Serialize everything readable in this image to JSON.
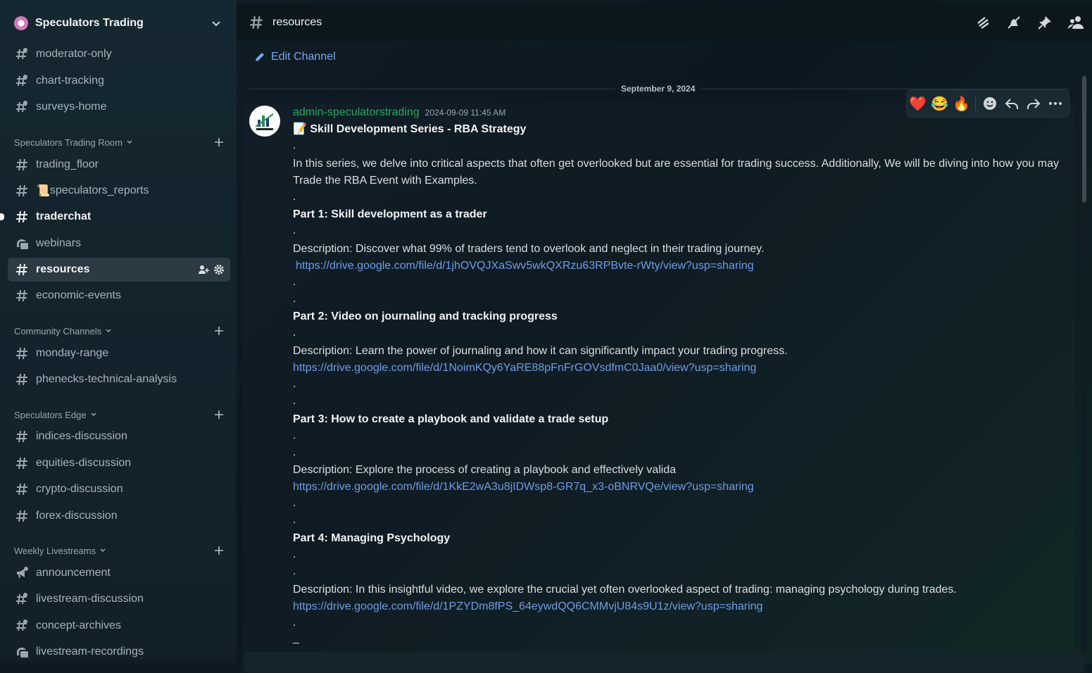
{
  "server": {
    "name": "Speculators Trading"
  },
  "sidebar": {
    "top_channels": [
      {
        "label": "moderator-only"
      },
      {
        "label": "chart-tracking"
      },
      {
        "label": "surveys-home"
      }
    ],
    "categories": [
      {
        "label": "Speculators Trading Room",
        "channels": [
          {
            "label": "trading_floor"
          },
          {
            "label": "speculators_reports",
            "emoji": "📜"
          },
          {
            "label": "traderchat"
          },
          {
            "label": "webinars"
          },
          {
            "label": "resources"
          },
          {
            "label": "economic-events"
          }
        ]
      },
      {
        "label": "Community Channels",
        "channels": [
          {
            "label": "monday-range"
          },
          {
            "label": "phenecks-technical-analysis"
          }
        ]
      },
      {
        "label": "Speculators Edge",
        "channels": [
          {
            "label": "indices-discussion"
          },
          {
            "label": "equities-discussion"
          },
          {
            "label": "crypto-discussion"
          },
          {
            "label": "forex-discussion"
          }
        ]
      },
      {
        "label": "Weekly Livestreams",
        "channels": [
          {
            "label": "announcement"
          },
          {
            "label": "livestream-discussion"
          },
          {
            "label": "concept-archives"
          },
          {
            "label": "livestream-recordings"
          }
        ]
      }
    ]
  },
  "header": {
    "channel_name": "resources"
  },
  "edit_channel_label": "Edit Channel",
  "date_divider": "September 9, 2024",
  "message": {
    "author": "admin-speculatorstrading",
    "timestamp": "2024-09-09 11:45 AM",
    "title_emoji": "📝",
    "title": "Skill Development Series - RBA Strategy",
    "dot": ".",
    "intro": "In this series, we delve into critical aspects that often get overlooked but are essential for trading success. Additionally, We will be diving into how you may Trade the RBA Event with Examples.",
    "parts": [
      {
        "heading": "Part 1: Skill development as a trader",
        "description": "Description: Discover what 99% of traders tend to overlook and neglect in their trading journey.",
        "link": "https://drive.google.com/file/d/1jhOVQJXaSwv5wkQXRzu63RPBvte-rWty/view?usp=sharing"
      },
      {
        "heading": "Part 2: Video on journaling and tracking progress",
        "description": "Description: Learn the power of journaling and how it can significantly impact your trading progress.",
        "link": "https://drive.google.com/file/d/1NoimKQy6YaRE88pFnFrGOVsdfmC0Jaa0/view?usp=sharing"
      },
      {
        "heading": "Part 3: How to create a playbook and validate a trade setup",
        "description": "Description: Explore the process of creating a playbook and effectively valida",
        "link": "https://drive.google.com/file/d/1KkE2wA3u8jIDWsp8-GR7q_x3-oBNRVQe/view?usp=sharing"
      },
      {
        "heading": "Part 4: Managing Psychology",
        "description": "Description: In this insightful video, we explore the crucial yet often overlooked aspect of trading: managing psychology during trades.",
        "link": "https://drive.google.com/file/d/1PZYDm8fPS_64eywdQQ6CMMvjU84s9U1z/view?usp=sharing"
      }
    ],
    "trailing_dash": "_"
  },
  "reactions": [
    "❤️",
    "😂",
    "🔥"
  ],
  "colors": {
    "author": "#2aa568",
    "link": "#6e9de6",
    "active_channel_bg": "#2b3a43"
  }
}
